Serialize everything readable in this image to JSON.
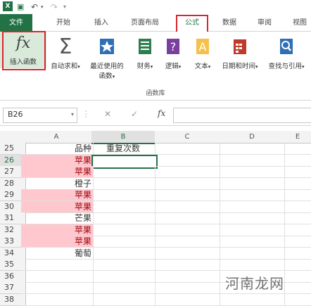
{
  "title_bar": {
    "app_icon": "excel-icon",
    "undo_icon": "undo-icon",
    "redo_icon": "redo-icon"
  },
  "tabs": [
    {
      "label": "文件"
    },
    {
      "label": "开始"
    },
    {
      "label": "插入"
    },
    {
      "label": "页面布局"
    },
    {
      "label": "公式"
    },
    {
      "label": "数据"
    },
    {
      "label": "审阅"
    },
    {
      "label": "视图"
    }
  ],
  "ribbon": {
    "group_label": "函数库",
    "buttons": [
      {
        "label1": "插入函数",
        "label2": "",
        "icon": "insert-function-icon"
      },
      {
        "label1": "自动求和",
        "label2": "",
        "icon": "autosum-icon"
      },
      {
        "label1": "最近使用的",
        "label2": "函数",
        "icon": "recently-used-icon"
      },
      {
        "label1": "财务",
        "label2": "",
        "icon": "financial-icon"
      },
      {
        "label1": "逻辑",
        "label2": "",
        "icon": "logical-icon"
      },
      {
        "label1": "文本",
        "label2": "",
        "icon": "text-icon"
      },
      {
        "label1": "日期和时间",
        "label2": "",
        "icon": "date-time-icon"
      },
      {
        "label1": "查找与引用",
        "label2": "",
        "icon": "lookup-reference-icon"
      }
    ]
  },
  "formula_bar": {
    "name_box": "B26",
    "fx": "fx",
    "cancel": "✕",
    "enter": "✓",
    "content": ""
  },
  "sheet": {
    "columns": [
      "A",
      "B",
      "C",
      "D",
      "E"
    ],
    "selected_column": "B",
    "selected_row": "26",
    "rows": [
      {
        "num": "25",
        "a": "品种",
        "b": "重复次数",
        "pink": false
      },
      {
        "num": "26",
        "a": "苹果",
        "b": "",
        "pink": true
      },
      {
        "num": "27",
        "a": "苹果",
        "b": "",
        "pink": true
      },
      {
        "num": "28",
        "a": "橙子",
        "b": "",
        "pink": false
      },
      {
        "num": "29",
        "a": "苹果",
        "b": "",
        "pink": true
      },
      {
        "num": "30",
        "a": "苹果",
        "b": "",
        "pink": true
      },
      {
        "num": "31",
        "a": "芒果",
        "b": "",
        "pink": false
      },
      {
        "num": "32",
        "a": "苹果",
        "b": "",
        "pink": true
      },
      {
        "num": "33",
        "a": "苹果",
        "b": "",
        "pink": true
      },
      {
        "num": "34",
        "a": "葡萄",
        "b": "",
        "pink": false
      },
      {
        "num": "35",
        "a": "",
        "b": "",
        "pink": false
      },
      {
        "num": "36",
        "a": "",
        "b": "",
        "pink": false
      },
      {
        "num": "37",
        "a": "",
        "b": "",
        "pink": false
      },
      {
        "num": "38",
        "a": "",
        "b": "",
        "pink": false
      }
    ]
  },
  "watermark": "河南龙网",
  "colors": {
    "excel_green": "#217346",
    "highlight_red": "#d9262e",
    "pink_fill": "#ffc7ce",
    "pink_text": "#9c0006"
  }
}
